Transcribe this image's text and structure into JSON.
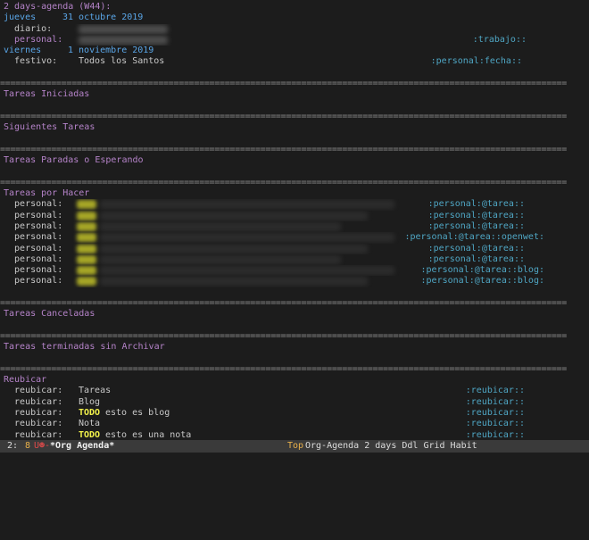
{
  "agenda": {
    "header": "2 days-agenda (W44):",
    "day1": {
      "name": "jueves",
      "date": "31 octubre 2019"
    },
    "day1_items": [
      {
        "prefix": "  diario:",
        "tags": ""
      },
      {
        "prefix": "  personal:",
        "tags": ":trabajo::"
      }
    ],
    "day2": {
      "name": "viernes",
      "date": "1 noviembre 2019"
    },
    "day2_items": [
      {
        "prefix": "  festivo:",
        "text": "Todos los Santos",
        "tags": ":personal:fecha::"
      }
    ]
  },
  "separator": "===============================================================================================================",
  "sections": {
    "iniciadas": "Tareas Iniciadas",
    "siguientes": "Siguientes Tareas",
    "paradas": "Tareas Paradas o Esperando",
    "por_hacer": "Tareas por Hacer",
    "canceladas": "Tareas Canceladas",
    "terminadas": "Tareas terminadas sin Archivar",
    "reubicar": "Reubicar"
  },
  "por_hacer_items": [
    {
      "prefix": "  personal:",
      "tags": ":personal:@tarea::"
    },
    {
      "prefix": "  personal:",
      "tags": ":personal:@tarea::"
    },
    {
      "prefix": "  personal:",
      "tags": ":personal:@tarea::"
    },
    {
      "prefix": "  personal:",
      "tags": ":personal:@tarea::openwet:"
    },
    {
      "prefix": "  personal:",
      "tags": ":personal:@tarea::"
    },
    {
      "prefix": "  personal:",
      "tags": ":personal:@tarea::"
    },
    {
      "prefix": "  personal:",
      "tags": ":personal:@tarea::blog:"
    },
    {
      "prefix": "  personal:",
      "tags": ":personal:@tarea::blog:"
    }
  ],
  "reubicar_items": [
    {
      "prefix": "  reubicar:",
      "keyword": "",
      "text": "Tareas",
      "tags": ":reubicar::"
    },
    {
      "prefix": "  reubicar:",
      "keyword": "",
      "text": "Blog",
      "tags": ":reubicar::"
    },
    {
      "prefix": "  reubicar:",
      "keyword": "TODO",
      "text": "esto es blog",
      "tags": ":reubicar::"
    },
    {
      "prefix": "  reubicar:",
      "keyword": "",
      "text": "Nota",
      "tags": ":reubicar::"
    },
    {
      "prefix": "  reubicar:",
      "keyword": "TODO",
      "text": "esto es una nota",
      "tags": ":reubicar::"
    }
  ],
  "modeline": {
    "window": "2:",
    "num": "8",
    "flags": "U",
    "state": "☻-",
    "buffer": "*Org Agenda*",
    "position": "Top",
    "modes": "Org-Agenda 2 days Ddl Grid Habit"
  },
  "colors": {
    "background": "#1c1c1c",
    "date": "#5aa6e8",
    "section": "#b583c9",
    "tags": "#4fa6c4",
    "todo": "#f1f14a"
  }
}
